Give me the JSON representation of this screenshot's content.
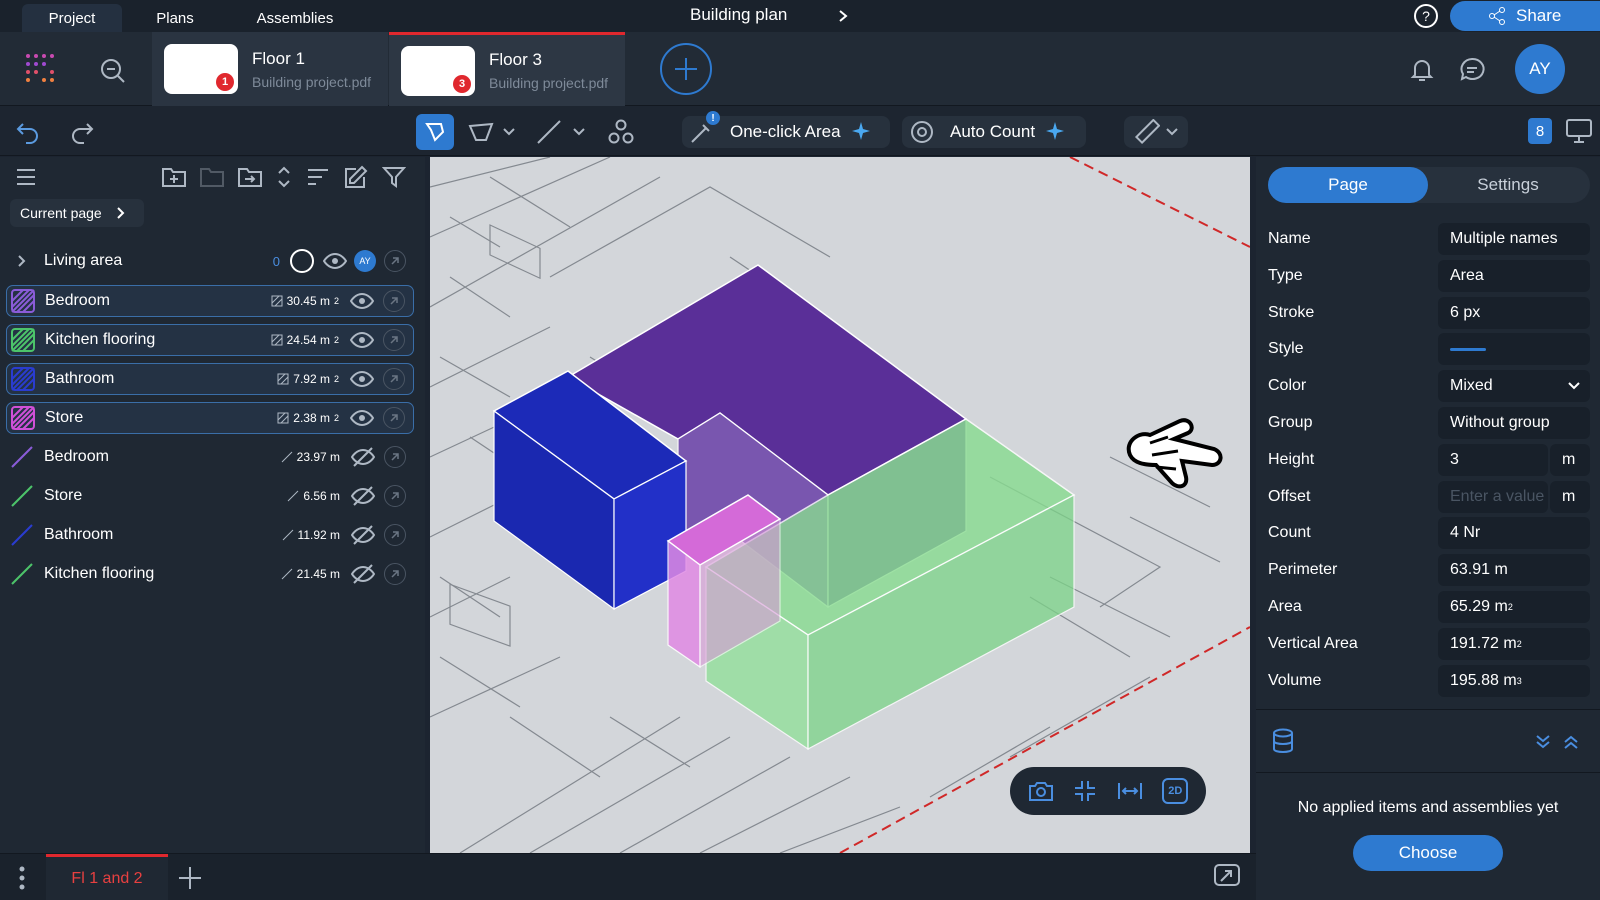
{
  "top": {
    "tabs": [
      "Project",
      "Plans",
      "Assemblies"
    ],
    "doc_title": "Building plan",
    "share": "Share"
  },
  "files": [
    {
      "name": "Floor 1",
      "sub": "Building project.pdf",
      "badge": "1"
    },
    {
      "name": "Floor 3",
      "sub": "Building project.pdf",
      "badge": "3"
    }
  ],
  "user": {
    "initials": "AY"
  },
  "toolbar": {
    "one_click": "One-click Area",
    "auto_count": "Auto Count",
    "count_badge": "8"
  },
  "left": {
    "current_page": "Current page",
    "group": {
      "label": "Living area",
      "count": "0",
      "avatar": "AY"
    },
    "items": [
      {
        "label": "Bedroom",
        "value": "30.45 m",
        "sup": "2",
        "color": "#8a5cd8",
        "kind": "area",
        "visible": true
      },
      {
        "label": "Kitchen flooring",
        "value": "24.54 m",
        "sup": "2",
        "color": "#4cc46a",
        "kind": "area",
        "visible": true
      },
      {
        "label": "Bathroom",
        "value": "7.92 m",
        "sup": "2",
        "color": "#2a3cd0",
        "kind": "area",
        "visible": true
      },
      {
        "label": "Store",
        "value": "2.38 m",
        "sup": "2",
        "color": "#d050d8",
        "kind": "area",
        "visible": true
      },
      {
        "label": "Bedroom",
        "value": "23.97 m",
        "sup": "",
        "color": "#8a5cd8",
        "kind": "line",
        "visible": false
      },
      {
        "label": "Store",
        "value": "6.56 m",
        "sup": "",
        "color": "#4cc46a",
        "kind": "line",
        "visible": false
      },
      {
        "label": "Bathroom",
        "value": "11.92 m",
        "sup": "",
        "color": "#2a3cd0",
        "kind": "line",
        "visible": false
      },
      {
        "label": "Kitchen flooring",
        "value": "21.45 m",
        "sup": "",
        "color": "#4cc46a",
        "kind": "line",
        "visible": false
      }
    ]
  },
  "right": {
    "tabs": [
      "Page",
      "Settings"
    ],
    "props": [
      {
        "k": "Name",
        "v": "Multiple names"
      },
      {
        "k": "Type",
        "v": "Area"
      },
      {
        "k": "Stroke",
        "v": "6 px"
      },
      {
        "k": "Style",
        "v": ""
      },
      {
        "k": "Color",
        "v": "Mixed"
      },
      {
        "k": "Group",
        "v": "Without group"
      },
      {
        "k": "Height",
        "v": "3",
        "unit": "m"
      },
      {
        "k": "Offset",
        "v": "",
        "placeholder": "Enter a value",
        "unit": "m"
      },
      {
        "k": "Count",
        "v": "4 Nr"
      },
      {
        "k": "Perimeter",
        "v": "63.91 m"
      },
      {
        "k": "Area",
        "v": "65.29 m",
        "sup": "2"
      },
      {
        "k": "Vertical Area",
        "v": "191.72 m",
        "sup": "2"
      },
      {
        "k": "Volume",
        "v": "195.88 m",
        "sup": "3"
      }
    ],
    "empty": "No applied items and assemblies yet",
    "choose": "Choose"
  },
  "bottom": {
    "page_tab": "Fl 1 and 2"
  },
  "canvas": {
    "mode": "2D"
  }
}
